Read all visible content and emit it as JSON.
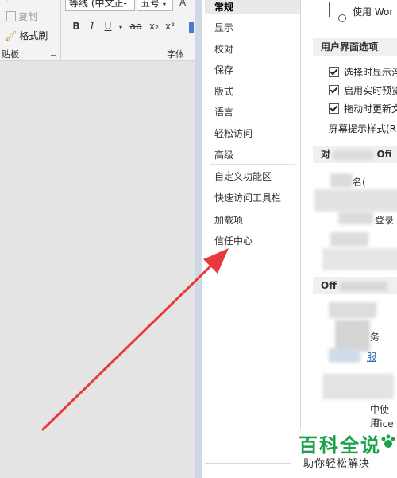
{
  "ribbon": {
    "clipboard": {
      "copy_label": "复制",
      "format_painter_label": "格式刷",
      "group_label": "贴板"
    },
    "font": {
      "family_value": "等线 (中文正‐",
      "size_value": "五号",
      "grow_label": "A",
      "group_label": "字体",
      "buttons": [
        "B",
        "I",
        "U",
        "ab",
        "x₂",
        "x²"
      ]
    }
  },
  "dialog": {
    "nav": {
      "items": [
        "常规",
        "显示",
        "校对",
        "保存",
        "版式",
        "语言",
        "轻松访问",
        "高级",
        "自定义功能区",
        "快速访问工具栏",
        "加载项",
        "信任中心"
      ],
      "selected": "常规"
    },
    "main": {
      "top_text": "使用 Wor",
      "ui_section_title": "用户界面选项",
      "options": [
        "选择时显示浮",
        "启用实时预览",
        "拖动时更新文"
      ],
      "tooltip_label": "屏幕提示样式(R)",
      "section2_title": "对",
      "section2_tail": "Ofi",
      "section3_title": "Off",
      "fragments": {
        "name": "名(",
        "login": "登录",
        "service": "务",
        "link": "服",
        "use": "中使用",
        "office": "ffice"
      }
    }
  },
  "watermark": {
    "title": "百科全说",
    "subtitle": "助你轻松解决"
  },
  "colors": {
    "arrow": "#e8393c",
    "watermark_green": "#1aa34a"
  }
}
